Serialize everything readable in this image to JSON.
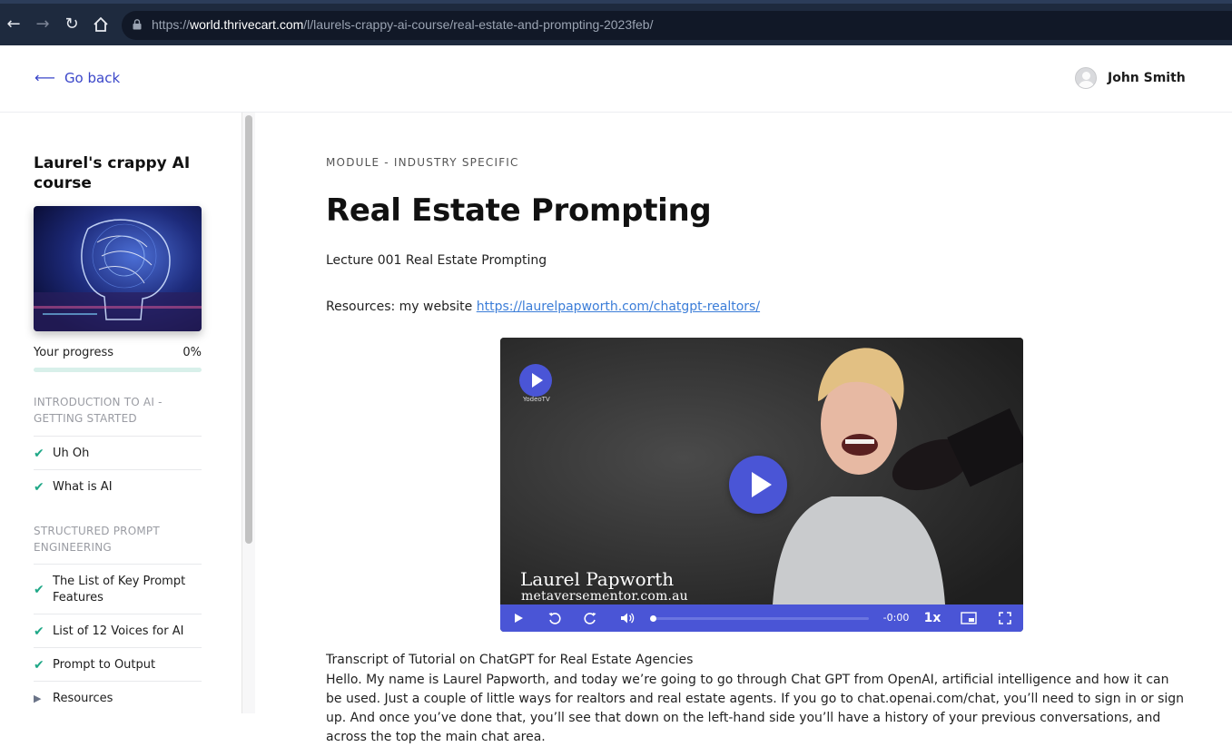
{
  "browser": {
    "url_prefix": "https://",
    "url_domain": "world.thrivecart.com",
    "url_path": "/l/laurels-crappy-ai-course/real-estate-and-prompting-2023feb/"
  },
  "header": {
    "back_label": "Go back",
    "user_name": "John Smith"
  },
  "sidebar": {
    "course_title": "Laurel's crappy AI course",
    "progress_label": "Your progress",
    "progress_value": "0%",
    "progress_fraction": 0,
    "sections": [
      {
        "title": "INTRODUCTION TO AI - GETTING STARTED",
        "lessons": [
          {
            "title": "Uh Oh",
            "state": "complete"
          },
          {
            "title": "What is AI",
            "state": "complete"
          }
        ]
      },
      {
        "title": "STRUCTURED PROMPT ENGINEERING",
        "lessons": [
          {
            "title": "The List of Key Prompt Features",
            "state": "complete"
          },
          {
            "title": "List of 12 Voices for AI",
            "state": "complete"
          },
          {
            "title": "Prompt to Output",
            "state": "complete"
          },
          {
            "title": "Resources",
            "state": "expandable"
          }
        ]
      }
    ]
  },
  "main": {
    "module_label": "MODULE - INDUSTRY SPECIFIC",
    "title": "Real Estate Prompting",
    "lecture_line": "Lecture 001 Real Estate Prompting",
    "resources_prefix": "Resources: my website ",
    "resources_link": "https://laurelpapworth.com/chatgpt-realtors/",
    "video": {
      "brand": "YodeoTV",
      "presenter_name": "Laurel Papworth",
      "presenter_site": "metaversementor.com.au",
      "time": "-0:00",
      "speed": "1x",
      "progress_fraction": 0
    },
    "transcript_heading": "Transcript of Tutorial on ChatGPT for Real Estate Agencies",
    "transcript_text": "Hello. My name is Laurel Papworth, and today we’re going to go through Chat GPT from OpenAI, artificial intelligence and how it can be used. Just a couple of little ways for realtors and real estate agents. If you go to chat.openai.com/chat, you’ll need to sign in or sign up. And once you’ve done that, you’ll see that down on the left-hand side you’ll have a history of your previous conversations, and across the top the main chat area."
  },
  "colors": {
    "accent": "#4a55d6",
    "link": "#3b7dd8",
    "check": "#1fa887",
    "browser_bar": "#1e2a3e"
  }
}
